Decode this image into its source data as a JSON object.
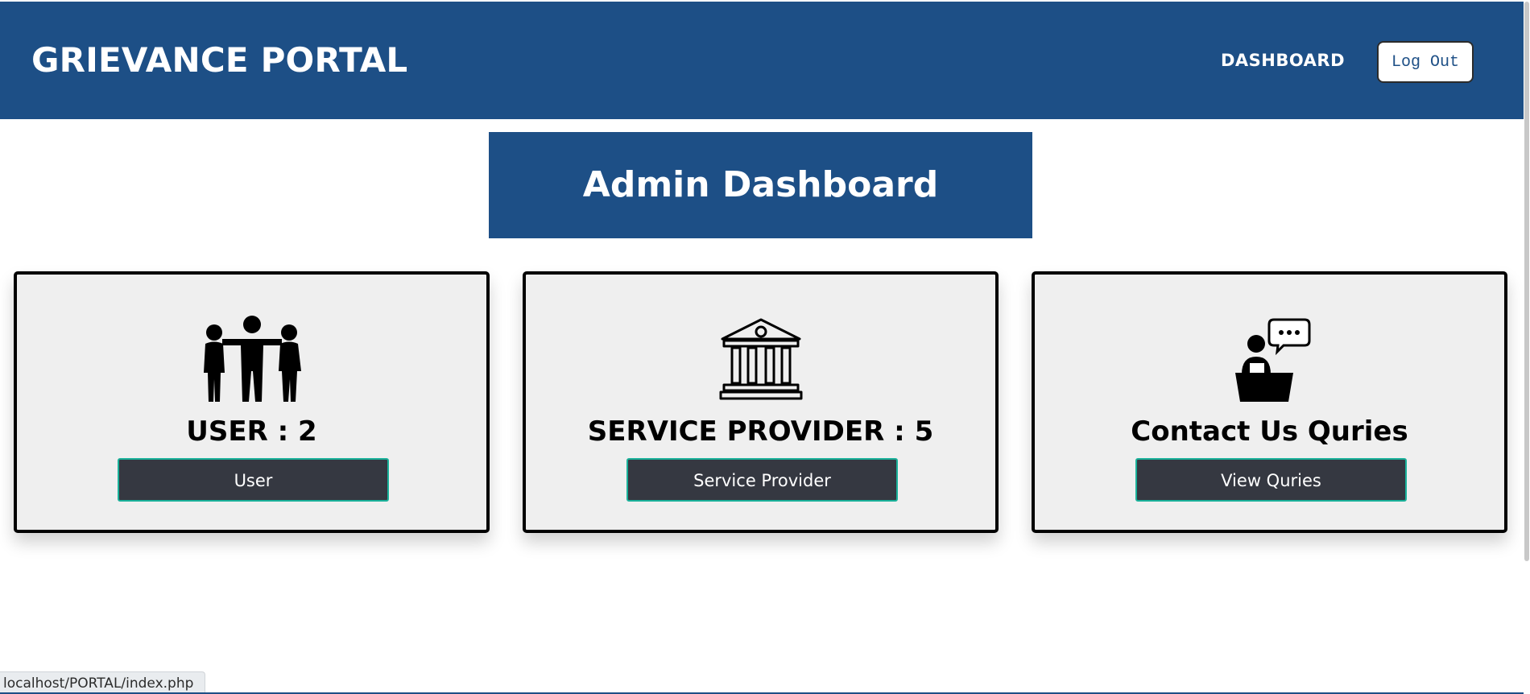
{
  "header": {
    "brand": "GRIEVANCE PORTAL",
    "nav_dashboard": "DASHBOARD",
    "logout_label": "Log Out"
  },
  "main": {
    "title": "Admin Dashboard",
    "cards": [
      {
        "icon": "users-group-icon",
        "title": "USER : 2",
        "button_label": "User"
      },
      {
        "icon": "government-building-icon",
        "title": "SERVICE PROVIDER : 5",
        "button_label": "Service Provider"
      },
      {
        "icon": "support-speaker-chat-icon",
        "title": "Contact Us Quries",
        "button_label": "View Quries"
      }
    ]
  },
  "statusbar": {
    "url": "localhost/PORTAL/index.php"
  },
  "colors": {
    "header_bg": "#1d4f86",
    "card_bg": "#efefef",
    "button_bg": "#353841",
    "button_border": "#19b19a"
  }
}
